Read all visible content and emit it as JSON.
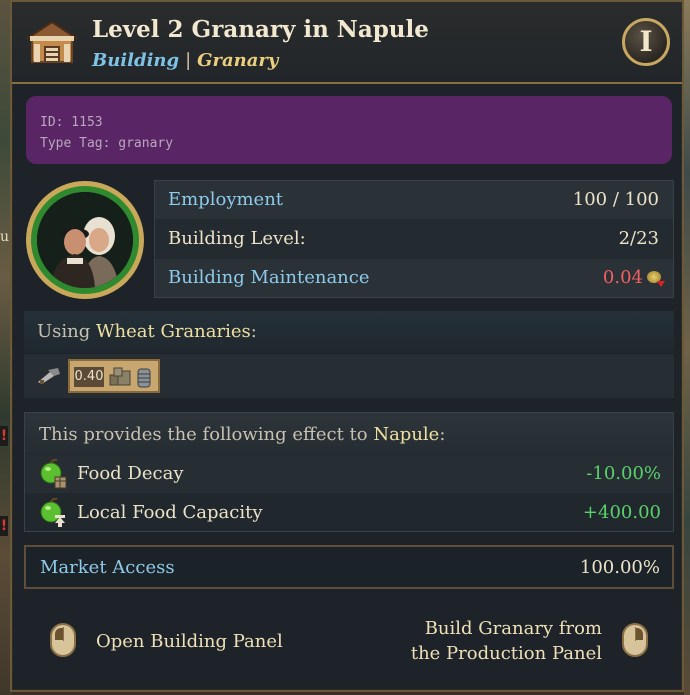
{
  "header": {
    "title": "Level 2 Granary in Napule",
    "kind": "Building",
    "separator": "|",
    "type": "Granary",
    "info_button": "I"
  },
  "debug": {
    "id_line": "ID: 1153",
    "tag_line": "Type Tag: granary"
  },
  "stats": {
    "employment_label": "Employment",
    "employment_value": "100 / 100",
    "level_label": "Building Level:",
    "level_value": "2/23",
    "maintenance_label": "Building Maintenance",
    "maintenance_value": "0.04"
  },
  "using": {
    "prefix": "Using ",
    "method": "Wheat Granaries",
    "suffix": ":",
    "good_value": "0.40"
  },
  "effects": {
    "intro_prefix": "This provides the following effect to ",
    "place": "Napule",
    "intro_suffix": ":",
    "rows": [
      {
        "label": "Food Decay",
        "value": "-10.00%"
      },
      {
        "label": "Local Food Capacity",
        "value": "+400.00"
      }
    ]
  },
  "market": {
    "label": "Market Access",
    "value": "100.00%"
  },
  "footer": {
    "left_action": "Open Building Panel",
    "right_action_line1": "Build Granary from",
    "right_action_line2": "the Production Panel"
  },
  "colors": {
    "accent_blue": "#8ecaea",
    "positive_green": "#5ad06a",
    "negative_red": "#f06060",
    "debug_purple": "#5a2565"
  }
}
